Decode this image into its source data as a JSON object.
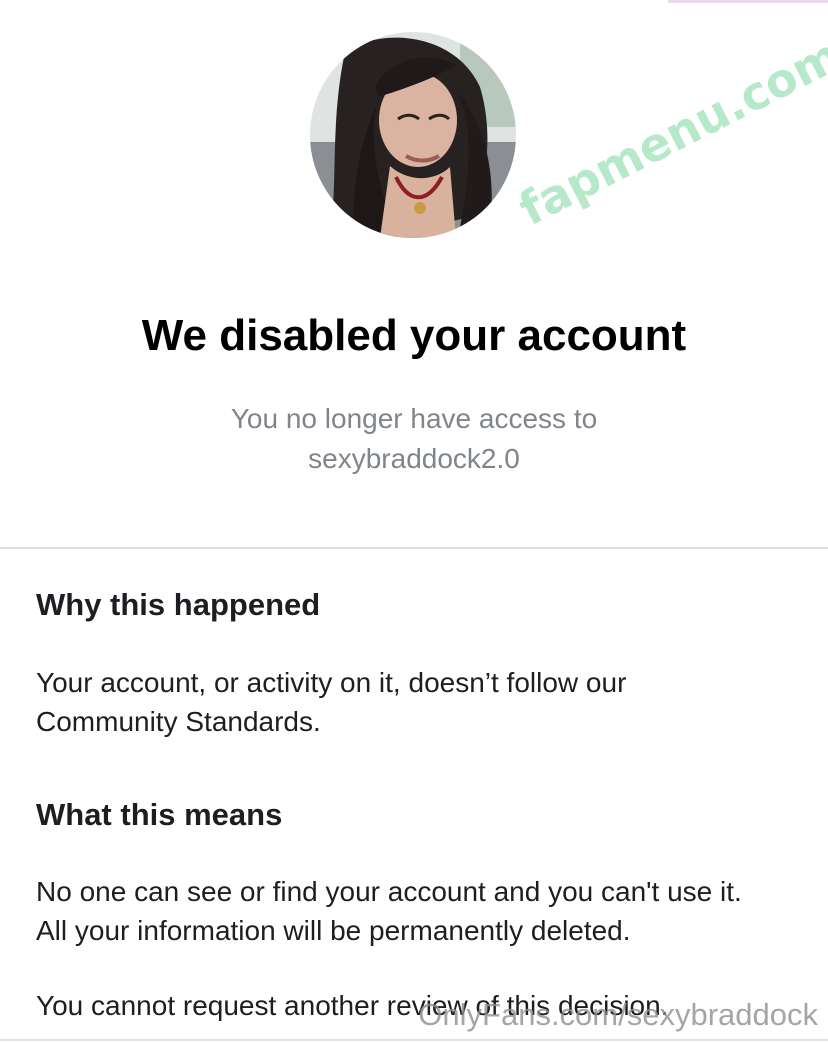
{
  "profile": {
    "avatar_icon": "user-avatar-photo"
  },
  "watermarks": {
    "top": "fapmenu.com",
    "bottom": "OnlyFans.com/sexybraddock"
  },
  "header": {
    "title": "We disabled your account",
    "subtitle_line1": "You no longer have access to",
    "subtitle_line2": "sexybraddock2.0"
  },
  "sections": {
    "why": {
      "heading": "Why this happened",
      "body_line1": "Your account, or activity on it, doesn’t follow our",
      "body_line2": "Community Standards."
    },
    "means": {
      "heading": "What this means",
      "body_line1": "No one can see or find your account and you can't use it.",
      "body_line2": "All your information will be permanently deleted.",
      "review_text": "You cannot request another review of this decision."
    }
  },
  "colors": {
    "title": "#000000",
    "subtitle": "#80858b",
    "body": "#1c1e21",
    "divider": "#dddfe2",
    "watermark_top": "#b2e8c8",
    "watermark_bottom": "#8f8f8f"
  }
}
